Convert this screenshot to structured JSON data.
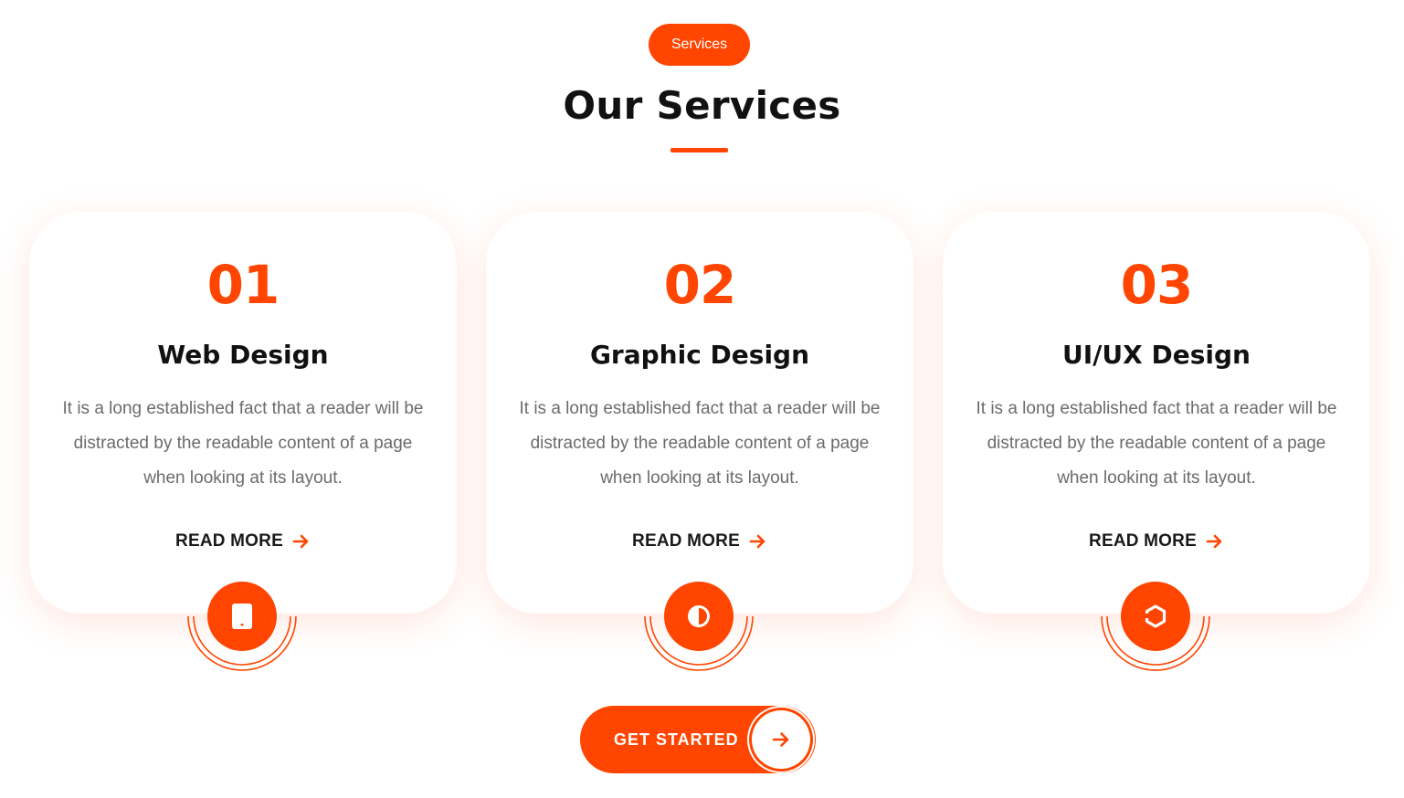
{
  "header": {
    "badge_label": "Services",
    "title": "Our Services"
  },
  "cards": [
    {
      "number": "01",
      "title": "Web Design",
      "description": "It is a long established fact that a reader will be distracted by the readable content of a page when looking at its layout.",
      "link_label": "READ MORE",
      "icon": "tablet-icon"
    },
    {
      "number": "02",
      "title": "Graphic Design",
      "description": "It is a long established fact that a reader will be distracted by the readable content of a page when looking at its layout.",
      "link_label": "READ MORE",
      "icon": "contrast-icon"
    },
    {
      "number": "03",
      "title": "UI/UX Design",
      "description": "It is a long established fact that a reader will be distracted by the readable content of a page when looking at its layout.",
      "link_label": "READ MORE",
      "icon": "cube-icon"
    }
  ],
  "cta": {
    "label": "GET STARTED",
    "icon": "arrow-right-icon"
  },
  "colors": {
    "accent": "#ff4500",
    "heading": "#111111",
    "body_text": "#6b6b6b",
    "background": "#ffffff"
  }
}
